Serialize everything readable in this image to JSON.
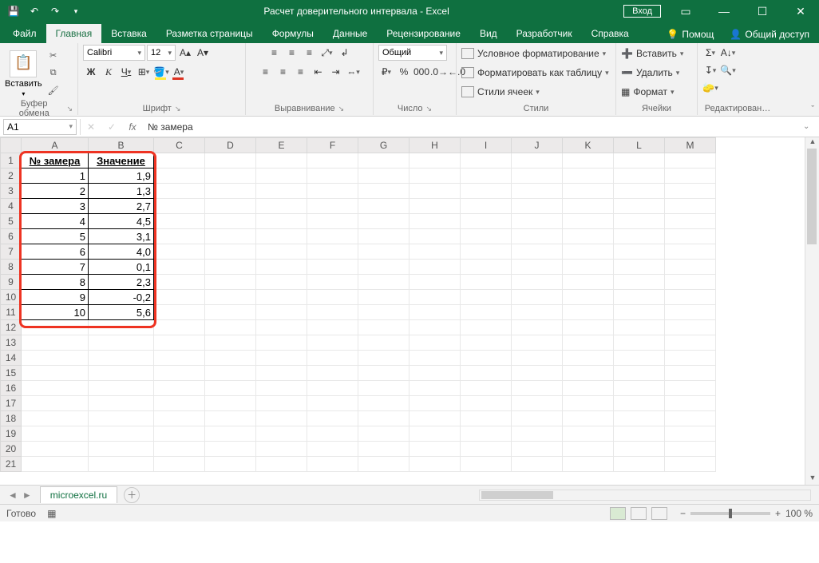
{
  "titlebar": {
    "title": "Расчет доверительного интервала - Excel",
    "signin": "Вход"
  },
  "tabs": {
    "file": "Файл",
    "home": "Главная",
    "insert": "Вставка",
    "pagelayout": "Разметка страницы",
    "formulas": "Формулы",
    "data": "Данные",
    "review": "Рецензирование",
    "view": "Вид",
    "developer": "Разработчик",
    "help": "Справка",
    "tellme": "Помощ",
    "share": "Общий доступ"
  },
  "ribbon": {
    "clipboard": {
      "paste": "Вставить",
      "label": "Буфер обмена"
    },
    "font": {
      "name": "Calibri",
      "size": "12",
      "label": "Шрифт",
      "bold": "Ж",
      "italic": "К",
      "underline": "Ч"
    },
    "alignment": {
      "label": "Выравнивание"
    },
    "number": {
      "format": "Общий",
      "label": "Число"
    },
    "styles": {
      "cond": "Условное форматирование",
      "table": "Форматировать как таблицу",
      "cell": "Стили ячеек",
      "label": "Стили"
    },
    "cells": {
      "insert": "Вставить",
      "delete": "Удалить",
      "format": "Формат",
      "label": "Ячейки"
    },
    "editing": {
      "label": "Редактирован…"
    }
  },
  "formulabar": {
    "name": "A1",
    "fx": "fx",
    "content": "№ замера"
  },
  "columns": [
    "A",
    "B",
    "C",
    "D",
    "E",
    "F",
    "G",
    "H",
    "I",
    "J",
    "K",
    "L",
    "M"
  ],
  "rownums": [
    "1",
    "2",
    "3",
    "4",
    "5",
    "6",
    "7",
    "8",
    "9",
    "10",
    "11",
    "12",
    "13",
    "14",
    "15",
    "16",
    "17",
    "18",
    "19",
    "20",
    "21"
  ],
  "data": {
    "header": {
      "a": "№ замера",
      "b": "Значение"
    },
    "rows": [
      {
        "a": "1",
        "b": "1,9"
      },
      {
        "a": "2",
        "b": "1,3"
      },
      {
        "a": "3",
        "b": "2,7"
      },
      {
        "a": "4",
        "b": "4,5"
      },
      {
        "a": "5",
        "b": "3,1"
      },
      {
        "a": "6",
        "b": "4,0"
      },
      {
        "a": "7",
        "b": "0,1"
      },
      {
        "a": "8",
        "b": "2,3"
      },
      {
        "a": "9",
        "b": "-0,2"
      },
      {
        "a": "10",
        "b": "5,6"
      }
    ]
  },
  "sheet": {
    "name": "microexcel.ru"
  },
  "status": {
    "ready": "Готово",
    "zoom": "100 %"
  }
}
